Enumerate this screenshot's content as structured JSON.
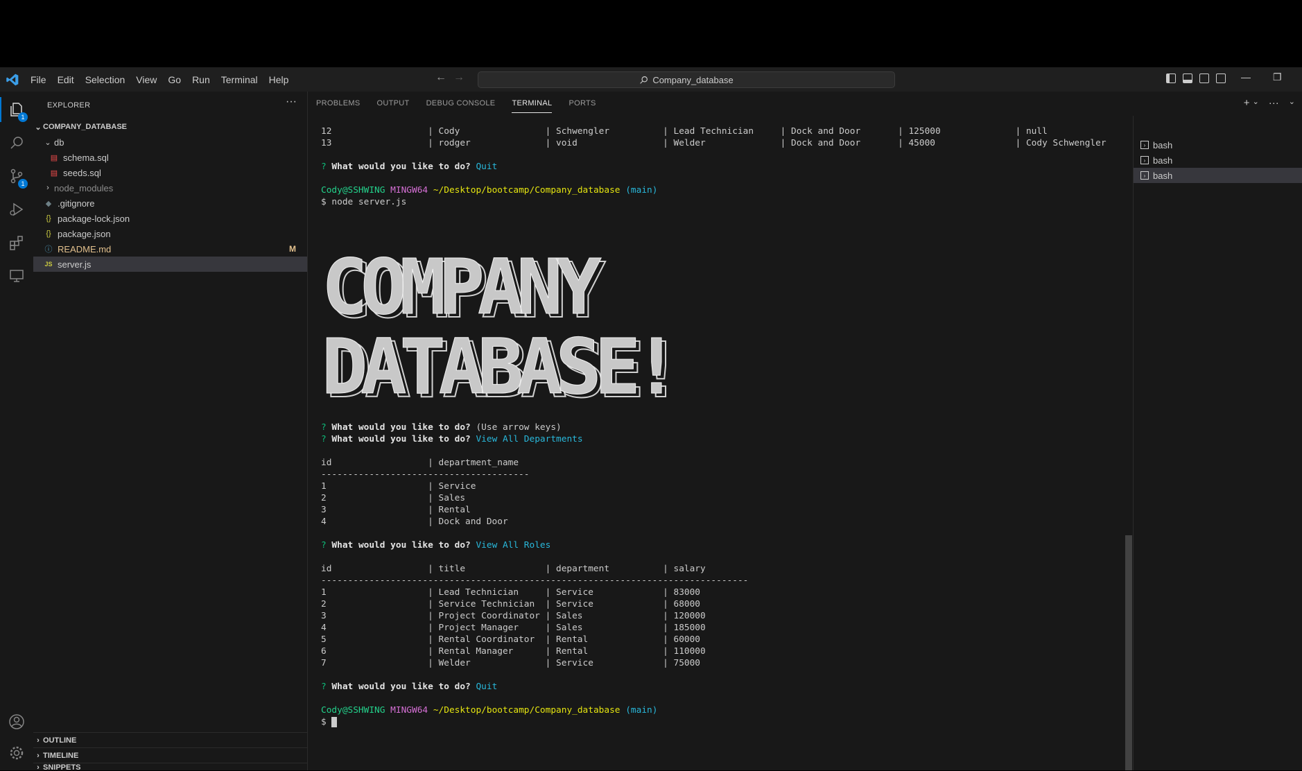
{
  "menu": [
    "File",
    "Edit",
    "Selection",
    "View",
    "Go",
    "Run",
    "Terminal",
    "Help"
  ],
  "search": {
    "text": "Company_database"
  },
  "explorer": {
    "title": "EXPLORER",
    "project": "COMPANY_DATABASE",
    "items": [
      {
        "label": "db"
      },
      {
        "label": "schema.sql"
      },
      {
        "label": "seeds.sql"
      },
      {
        "label": "node_modules"
      },
      {
        "label": ".gitignore"
      },
      {
        "label": "package-lock.json"
      },
      {
        "label": "package.json"
      },
      {
        "label": "README.md",
        "badge": "M"
      },
      {
        "label": "server.js"
      }
    ],
    "bottom": [
      "OUTLINE",
      "TIMELINE",
      "SNIPPETS"
    ]
  },
  "badges": {
    "explorer": "1",
    "scm": "1"
  },
  "panel": {
    "tabs": [
      "PROBLEMS",
      "OUTPUT",
      "DEBUG CONSOLE",
      "TERMINAL",
      "PORTS"
    ]
  },
  "terminal": {
    "row12": "12                  | Cody                | Schwengler          | Lead Technician     | Dock and Door       | 125000              | null",
    "row13": "13                  | rodger              | void                | Welder              | Dock and Door       | 45000               | Cody Schwengler",
    "question": "What would you like to do?",
    "quit": "Quit",
    "user": "Cody@SSHWING",
    "host": "MINGW64",
    "path": "~/Desktop/bootcamp/Company_database",
    "branch": "(main)",
    "cmd": "$ node server.js",
    "banner1": "COMPANY",
    "banner2": "DATABASE!",
    "use_arrow": " (Use arrow keys)",
    "view_deps": "View All Departments",
    "dept_header": "id                  | department_name",
    "dept_sep": "---------------------------------------",
    "depts": [
      "1                   | Service",
      "2                   | Sales",
      "3                   | Rental",
      "4                   | Dock and Door"
    ],
    "view_roles": "View All Roles",
    "roles_header": "id                  | title               | department          | salary",
    "roles_sep": "--------------------------------------------------------------------------------",
    "roles": [
      "1                   | Lead Technician     | Service             | 83000",
      "2                   | Service Technician  | Service             | 68000",
      "3                   | Project Coordinator | Sales               | 120000",
      "4                   | Project Manager     | Sales               | 185000",
      "5                   | Rental Coordinator  | Rental              | 60000",
      "6                   | Rental Manager      | Rental              | 110000",
      "7                   | Welder              | Service             | 75000"
    ],
    "prompt": "$ "
  },
  "terminals": [
    "bash",
    "bash",
    "bash"
  ]
}
